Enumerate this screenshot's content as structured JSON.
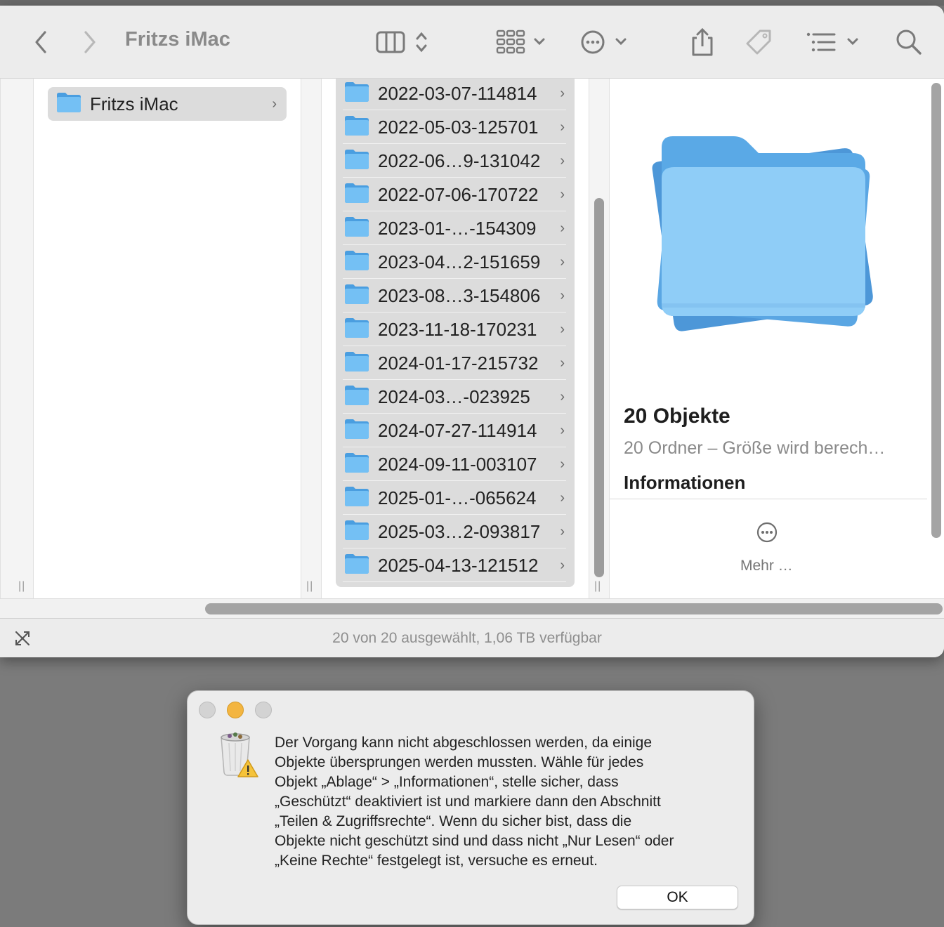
{
  "window": {
    "title": "Fritzs iMac",
    "status": "20 von 20 ausgewählt, 1,06 TB verfügbar"
  },
  "toolbar": {
    "icons": [
      "back-icon",
      "forward-icon",
      "columns-view-icon",
      "gallery-view-icon",
      "action-menu-icon",
      "share-icon",
      "tag-icon",
      "group-icon",
      "search-icon"
    ]
  },
  "sidebar_column": {
    "items": [
      {
        "label": "Fritzs iMac"
      }
    ]
  },
  "folder_column": {
    "items": [
      {
        "label": "2022-03-07-114814"
      },
      {
        "label": "2022-05-03-125701"
      },
      {
        "label": "2022-06…9-131042"
      },
      {
        "label": "2022-07-06-170722"
      },
      {
        "label": "2023-01-…-154309"
      },
      {
        "label": "2023-04…2-151659"
      },
      {
        "label": "2023-08…3-154806"
      },
      {
        "label": "2023-11-18-170231"
      },
      {
        "label": "2024-01-17-215732"
      },
      {
        "label": "2024-03…-023925"
      },
      {
        "label": "2024-07-27-114914"
      },
      {
        "label": "2024-09-11-003107"
      },
      {
        "label": "2025-01-…-065624"
      },
      {
        "label": "2025-03…2-093817"
      },
      {
        "label": "2025-04-13-121512"
      }
    ]
  },
  "preview": {
    "title": "20 Objekte",
    "subtitle": "20 Ordner – Größe wird berech…",
    "info_heading": "Informationen",
    "more_label": "Mehr …"
  },
  "dialog": {
    "message": "Der Vorgang kann nicht abgeschlossen werden, da einige\nObjekte übersprungen werden mussten. Wähle für jedes\nObjekt „Ablage“ > „Informationen“, stelle sicher, dass\n„Geschützt“ deaktiviert ist und markiere dann den Abschnitt\n„Teilen & Zugriffsrechte“. Wenn du sicher bist, dass die\nObjekte nicht geschützt sind und dass nicht „Nur Lesen“ oder\n„Keine Rechte“ festgelegt ist, versuche es erneut.",
    "ok_label": "OK"
  },
  "colors": {
    "folder_blue": "#6cb8ee",
    "selection_gray": "#dcdcdc",
    "minimize_yellow": "#f3b540"
  }
}
